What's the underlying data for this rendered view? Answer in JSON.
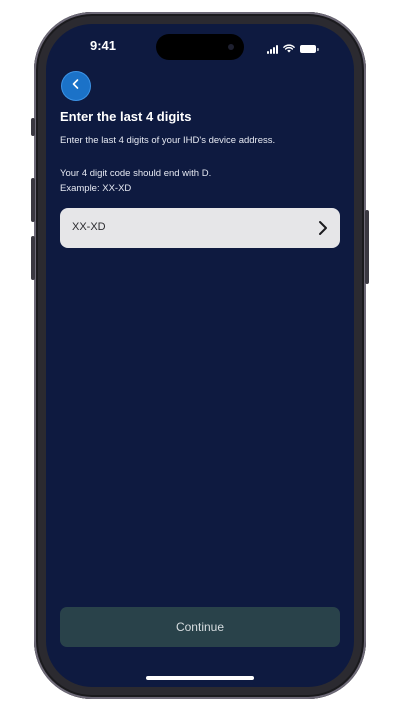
{
  "status_bar": {
    "time": "9:41",
    "icons": [
      "cellular-signal-icon",
      "wifi-icon",
      "battery-icon"
    ]
  },
  "header": {
    "back_icon": "chevron-left-icon",
    "title": "Enter the last 4 digits",
    "subtitle": "Enter the last 4 digits of your IHD's device address."
  },
  "hint": {
    "line1": "Your 4 digit code should end with D.",
    "line2": "Example: XX-XD"
  },
  "code_field": {
    "value": "XX-XD",
    "icon": "chevron-right-icon"
  },
  "footer": {
    "continue_label": "Continue"
  },
  "colors": {
    "background": "#0e1a40",
    "accent": "#1b72c8",
    "field": "#e6e6e8",
    "button": "#29424a"
  }
}
